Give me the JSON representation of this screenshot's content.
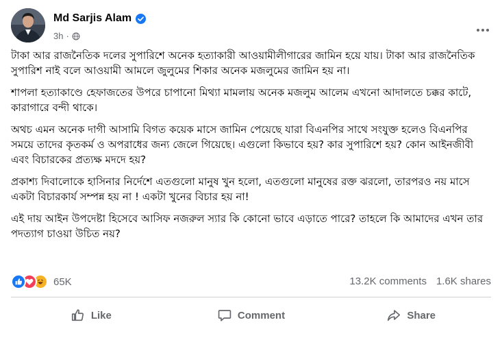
{
  "post": {
    "author": "Md Sarjis Alam",
    "time": "3h",
    "paragraphs": [
      "টাকা আর রাজনৈতিক দলের সুপারিশে অনেক হত্যাকারী আওয়ামীলীগারের জামিন হয়ে যায়। টাকা আর রাজনৈতিক সুপারিশ নাই বলে আওয়ামী আমলে জুলুমের শিকার অনেক মজলুমের জামিন হয় না।",
      "শাপলা হত্যাকাণ্ডে হেফাজতের উপরে চাপানো মিথ্যা মামলায় অনেক মজলুম আলেম এখনো আদালতে চক্কর কাটে, কারাগারে বন্দী থাকে।",
      "অথচ এমন অনেক দাগী আসামি বিগত কয়েক মাসে জামিন পেয়েছে যারা বিএনপির সাথে সংযুক্ত হলেও বিএনপির সময়ে তাদের কৃতকর্ম ও অপরাধের জন্য জেলে গিয়েছে। এগুলো কিভাবে হয়? কার সুপারিশে হয়? কোন আইনজীবী এবং বিচারকের প্রত্যক্ষ মদদে হয়?",
      "প্রকাশ্য দিবালোকে হাসিনার নির্দেশে এতগুলো মানুষ খুন হলো, এতগুলো মানুষের রক্ত ঝরলো, তারপরও নয় মাসে একটা বিচারকার্য সম্পন্ন হয় না ! একটা খুনের বিচার হয় না!",
      "এই দায় আইন উপদেষ্টা হিসেবে আসিফ নজরুল স্যার কি কোনো ভাবে এড়াতে পারে? তাহলে কি আমাদের এখন তার পদত্যাগ চাওয়া উচিত নয়?"
    ]
  },
  "stats": {
    "reaction_count": "65K",
    "comments": "13.2K comments",
    "shares": "1.6K shares"
  },
  "actions": {
    "like": "Like",
    "comment": "Comment",
    "share": "Share"
  },
  "icons": {
    "verified": "verified-badge-icon",
    "privacy": "globe-icon",
    "more": "more-options-icon",
    "reactions": [
      "like-reaction-icon",
      "love-reaction-icon",
      "haha-reaction-icon"
    ]
  },
  "colors": {
    "verified": "#1877f2",
    "like": "#1877f2",
    "love": "#f33e58",
    "haha": "#f7b125",
    "muted_text": "#65676b"
  }
}
